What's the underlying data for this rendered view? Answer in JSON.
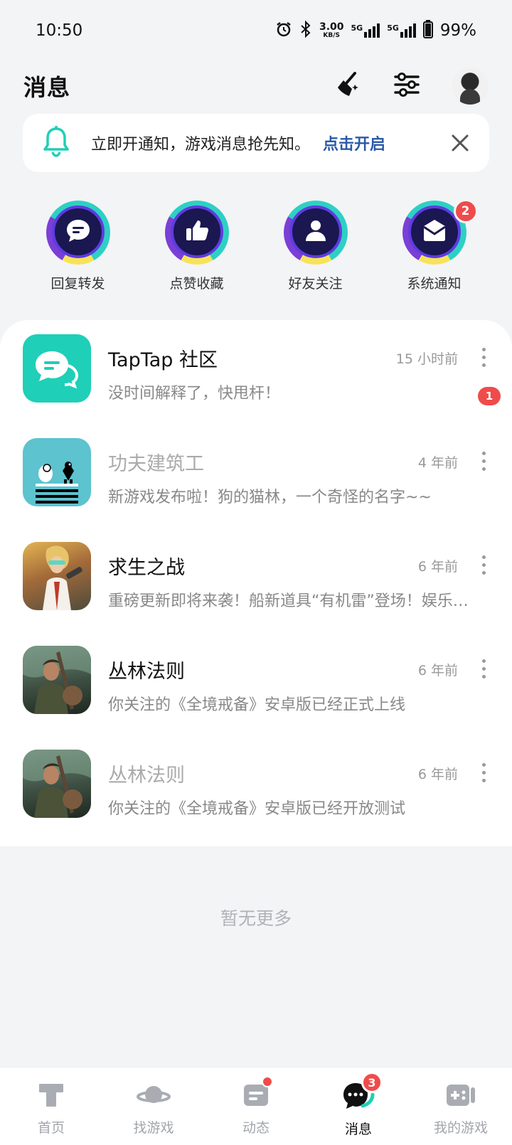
{
  "status_bar": {
    "time": "10:50",
    "speed_value": "3.00",
    "speed_unit": "KB/S",
    "network_1": "5G",
    "network_2": "5G",
    "battery": "99%",
    "icons": [
      "alarm-icon",
      "bluetooth-icon",
      "signal-icon",
      "battery-icon"
    ]
  },
  "header": {
    "title": "消息",
    "actions": [
      "clean-broom-icon",
      "settings-sliders-icon",
      "avatar"
    ]
  },
  "notice": {
    "text": "立即开通知，游戏消息抢先知。",
    "link": "点击开启",
    "icon": "bell-icon",
    "close_icon": "close-icon"
  },
  "categories": [
    {
      "label": "回复转发",
      "icon": "chat-bubble-icon",
      "badge": null
    },
    {
      "label": "点赞收藏",
      "icon": "thumbs-up-icon",
      "badge": null
    },
    {
      "label": "好友关注",
      "icon": "person-icon",
      "badge": null
    },
    {
      "label": "系统通知",
      "icon": "envelope-icon",
      "badge": "2"
    }
  ],
  "messages": [
    {
      "title": "TapTap 社区",
      "preview": "没时间解释了，快甩杆！",
      "time": "15 小时前",
      "unread": "1",
      "muted": false
    },
    {
      "title": "功夫建筑工",
      "preview": "新游戏发布啦！狗的猫林，一个奇怪的名字~~",
      "time": "4 年前",
      "unread": null,
      "muted": true
    },
    {
      "title": "求生之战",
      "preview": "重磅更新即将来袭！船新道具“有机雷”登场！娱乐模式上线",
      "time": "6 年前",
      "unread": null,
      "muted": false
    },
    {
      "title": "丛林法则",
      "preview": "你关注的《全境戒备》安卓版已经正式上线",
      "time": "6 年前",
      "unread": null,
      "muted": false
    },
    {
      "title": "丛林法则",
      "preview": "你关注的《全境戒备》安卓版已经开放测试",
      "time": "6 年前",
      "unread": null,
      "muted": true
    }
  ],
  "footer_text": "暂无更多",
  "bottom_nav": [
    {
      "label": "首页",
      "icon": "home-icon",
      "active": false
    },
    {
      "label": "找游戏",
      "icon": "planet-icon",
      "active": false
    },
    {
      "label": "动态",
      "icon": "feed-icon",
      "active": false,
      "dot": true
    },
    {
      "label": "消息",
      "icon": "message-icon",
      "active": true,
      "badge": "3"
    },
    {
      "label": "我的游戏",
      "icon": "gamepad-icon",
      "active": false
    }
  ],
  "colors": {
    "accent_teal": "#1fcfb7",
    "link_blue": "#2b5aa8",
    "badge_red": "#f04b4b",
    "background": "#f3f4f6"
  }
}
